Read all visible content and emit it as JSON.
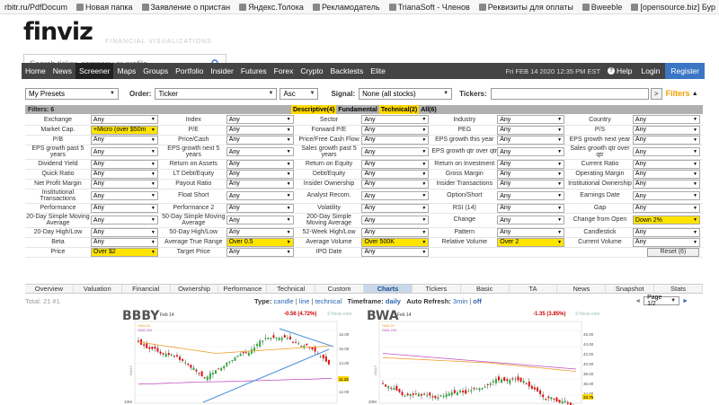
{
  "bookmarks": [
    {
      "label": "rbitr.ru/PdfDocum"
    },
    {
      "label": "Новая папка"
    },
    {
      "label": "Заявление о пристан"
    },
    {
      "label": "Яндекс.Толока"
    },
    {
      "label": "Рекламодатель"
    },
    {
      "label": "TrianaSoft - Членов"
    },
    {
      "label": "Реквизиты для оплаты"
    },
    {
      "label": "Bweeble"
    },
    {
      "label": "[opensource.biz] Бур"
    },
    {
      "label": "Инструменты для быс"
    }
  ],
  "bookmarks_more": "»",
  "bookmarks_other": "Другие закладки",
  "brand": {
    "name": "finviz",
    "tagline": "FINANCIAL VISUALIZATIONS"
  },
  "search": {
    "placeholder": "Search ticker, company or profile"
  },
  "nav": {
    "items": [
      "Home",
      "News",
      "Screener",
      "Maps",
      "Groups",
      "Portfolio",
      "Insider",
      "Futures",
      "Forex",
      "Crypto",
      "Backtests",
      "Elite"
    ],
    "active": "Screener",
    "datetime": "Fri FEB 14 2020 12:35 PM EST",
    "help": "Help",
    "login": "Login",
    "register": "Register"
  },
  "controls": {
    "presets": "My Presets",
    "order_label": "Order:",
    "order_value": "Ticker",
    "direction": "Asc",
    "signal_label": "Signal:",
    "signal_value": "None (all stocks)",
    "tickers_label": "Tickers:",
    "go": ">",
    "filters": "Filters"
  },
  "filter_header": {
    "count": "Filters: 6",
    "tabs": [
      "Descriptive(4)",
      "Fundamental",
      "Technical(2)",
      "All(6)"
    ]
  },
  "filters": [
    [
      {
        "label": "Exchange",
        "value": "Any"
      },
      {
        "label": "Index",
        "value": "Any"
      },
      {
        "label": "Sector",
        "value": "Any"
      },
      {
        "label": "Industry",
        "value": "Any"
      },
      {
        "label": "Country",
        "value": "Any"
      }
    ],
    [
      {
        "label": "Market Cap.",
        "value": "+Micro (over $50m",
        "hl": true
      },
      {
        "label": "P/E",
        "value": "Any"
      },
      {
        "label": "Forward P/E",
        "value": "Any"
      },
      {
        "label": "PEG",
        "value": "Any"
      },
      {
        "label": "P/S",
        "value": "Any"
      }
    ],
    [
      {
        "label": "P/B",
        "value": "Any"
      },
      {
        "label": "Price/Cash",
        "value": "Any"
      },
      {
        "label": "Price/Free Cash Flow",
        "value": "Any"
      },
      {
        "label": "EPS growth this year",
        "value": "Any"
      },
      {
        "label": "EPS growth next year",
        "value": "Any"
      }
    ],
    [
      {
        "label": "EPS growth past 5 years",
        "value": "Any"
      },
      {
        "label": "EPS growth next 5 years",
        "value": "Any"
      },
      {
        "label": "Sales growth past 5 years",
        "value": "Any"
      },
      {
        "label": "EPS growth qtr over qtr",
        "value": "Any"
      },
      {
        "label": "Sales growth qtr over qtr",
        "value": "Any"
      }
    ],
    [
      {
        "label": "Dividend Yield",
        "value": "Any"
      },
      {
        "label": "Return on Assets",
        "value": "Any"
      },
      {
        "label": "Return on Equity",
        "value": "Any"
      },
      {
        "label": "Return on Investment",
        "value": "Any"
      },
      {
        "label": "Current Ratio",
        "value": "Any"
      }
    ],
    [
      {
        "label": "Quick Ratio",
        "value": "Any"
      },
      {
        "label": "LT Debt/Equity",
        "value": "Any"
      },
      {
        "label": "Debt/Equity",
        "value": "Any"
      },
      {
        "label": "Gross Margin",
        "value": "Any"
      },
      {
        "label": "Operating Margin",
        "value": "Any"
      }
    ],
    [
      {
        "label": "Net Profit Margin",
        "value": "Any"
      },
      {
        "label": "Payout Ratio",
        "value": "Any"
      },
      {
        "label": "Insider Ownership",
        "value": "Any"
      },
      {
        "label": "Insider Transactions",
        "value": "Any"
      },
      {
        "label": "Institutional Ownership",
        "value": "Any"
      }
    ],
    [
      {
        "label": "Institutional Transactions",
        "value": "Any"
      },
      {
        "label": "Float Short",
        "value": "Any"
      },
      {
        "label": "Analyst Recom.",
        "value": "Any"
      },
      {
        "label": "Option/Short",
        "value": "Any"
      },
      {
        "label": "Earnings Date",
        "value": "Any"
      }
    ],
    [
      {
        "label": "Performance",
        "value": "Any"
      },
      {
        "label": "Performance 2",
        "value": "Any"
      },
      {
        "label": "Volatility",
        "value": "Any"
      },
      {
        "label": "RSI (14)",
        "value": "Any"
      },
      {
        "label": "Gap",
        "value": "Any"
      }
    ],
    [
      {
        "label": "20-Day Simple Moving Average",
        "value": "Any"
      },
      {
        "label": "50-Day Simple Moving Average",
        "value": "Any"
      },
      {
        "label": "200-Day Simple Moving Average",
        "value": "Any"
      },
      {
        "label": "Change",
        "value": "Any"
      },
      {
        "label": "Change from Open",
        "value": "Down 2%",
        "hl": true
      }
    ],
    [
      {
        "label": "20-Day High/Low",
        "value": "Any"
      },
      {
        "label": "50-Day High/Low",
        "value": "Any"
      },
      {
        "label": "52-Week High/Low",
        "value": "Any"
      },
      {
        "label": "Pattern",
        "value": "Any"
      },
      {
        "label": "Candlestick",
        "value": "Any"
      }
    ],
    [
      {
        "label": "Beta",
        "value": "Any"
      },
      {
        "label": "Average True Range",
        "value": "Over 0.5",
        "hl": true
      },
      {
        "label": "Average Volume",
        "value": "Over 500K",
        "hl": true
      },
      {
        "label": "Relative Volume",
        "value": "Over 2",
        "hl": true
      },
      {
        "label": "Current Volume",
        "value": "Any"
      }
    ],
    [
      {
        "label": "Price",
        "value": "Over $2",
        "hl": true
      },
      {
        "label": "Target Price",
        "value": "Any"
      },
      {
        "label": "IPO Date",
        "value": "Any"
      }
    ]
  ],
  "reset": "Reset (6)",
  "view_tabs": [
    "Overview",
    "Valuation",
    "Financial",
    "Ownership",
    "Performance",
    "Technical",
    "Custom",
    "Charts",
    "Tickers",
    "Basic",
    "TA",
    "News",
    "Snapshot",
    "Stats"
  ],
  "view_active": "Charts",
  "results": {
    "total": "Total: 21 #1",
    "type_label": "Type:",
    "type_candle": "candle",
    "type_line": "line",
    "type_technical": "technical",
    "timeframe_label": "Timeframe:",
    "timeframe_value": "daily",
    "refresh_label": "Auto Refresh:",
    "refresh_3min": "3min",
    "refresh_off": "off",
    "page": "Page 1/2"
  },
  "charts": [
    {
      "ticker": "BBBY",
      "date": "Feb 14",
      "change": "-0.56 (4.72%)",
      "watermark": "© finviz.com",
      "side_label": "DAILY",
      "sma1": "SMA 50",
      "sma2": "SMA 200",
      "last": "11.26",
      "price_ticks": [
        "16.00",
        "15.00",
        "14.00",
        "13.00",
        "12.00"
      ],
      "vol_tick": "10M",
      "accent": "#ffd800"
    },
    {
      "ticker": "BWA",
      "date": "Feb 14",
      "change": "-1.35 (3.85%)",
      "watermark": "© finviz.com",
      "side_label": "DAILY",
      "sma1": "SMA 50",
      "sma2": "SMA 200",
      "last": "33.75",
      "price_ticks": [
        "46.00",
        "44.00",
        "42.00",
        "40.00",
        "38.00",
        "36.00",
        "34.00"
      ],
      "vol_tick": "20M",
      "accent": "#ffd800"
    }
  ]
}
